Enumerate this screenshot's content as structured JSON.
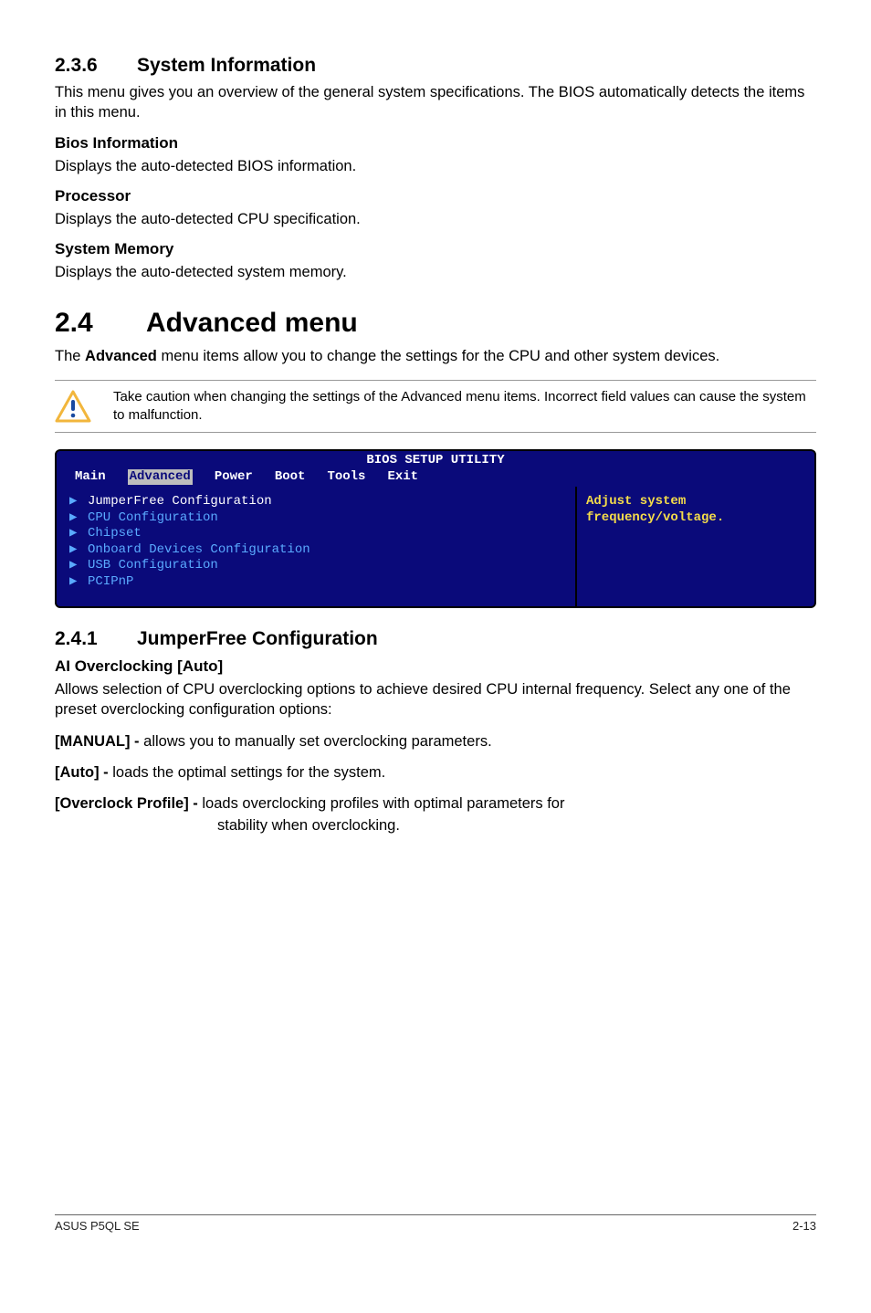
{
  "s236": {
    "num": "2.3.6",
    "title": "System Information",
    "intro": "This menu gives you an overview of the general system specifications. The BIOS automatically detects the items in this menu.",
    "bios_info_h": "Bios Information",
    "bios_info_p": "Displays the auto-detected BIOS information.",
    "proc_h": "Processor",
    "proc_p": "Displays the auto-detected CPU specification.",
    "mem_h": "System Memory",
    "mem_p": "Displays the auto-detected system memory."
  },
  "s24": {
    "num": "2.4",
    "title": "Advanced menu",
    "intro_pre": "The ",
    "intro_bold": "Advanced",
    "intro_post": " menu items allow you to change the settings for the CPU and other system devices.",
    "note": "Take caution when changing the settings of the Advanced menu items. Incorrect field values can cause the system to malfunction."
  },
  "bios": {
    "title": "BIOS SETUP UTILITY",
    "tabs": [
      "Main",
      "Advanced",
      "Power",
      "Boot",
      "Tools",
      "Exit"
    ],
    "items": [
      "JumperFree Configuration",
      "CPU Configuration",
      "Chipset",
      "Onboard Devices Configuration",
      "USB Configuration",
      "PCIPnP"
    ],
    "help1": "Adjust system",
    "help2": "frequency/voltage."
  },
  "s241": {
    "num": "2.4.1",
    "title": "JumperFree Configuration",
    "ai_h": "AI Overclocking [Auto]",
    "ai_p": "Allows selection of CPU overclocking options to achieve desired CPU internal frequency. Select any one of the preset overclocking configuration options:",
    "manual_b": "[MANUAL] - ",
    "manual_t": "allows you to manually set overclocking parameters.",
    "auto_b": "[Auto] - ",
    "auto_t": "loads the optimal settings for the system.",
    "oc_b": "[Overclock Profile] - ",
    "oc_t1": "loads overclocking profiles with optimal parameters for",
    "oc_t2": "stability when overclocking."
  },
  "footer": {
    "left": "ASUS P5QL SE",
    "right": "2-13"
  }
}
